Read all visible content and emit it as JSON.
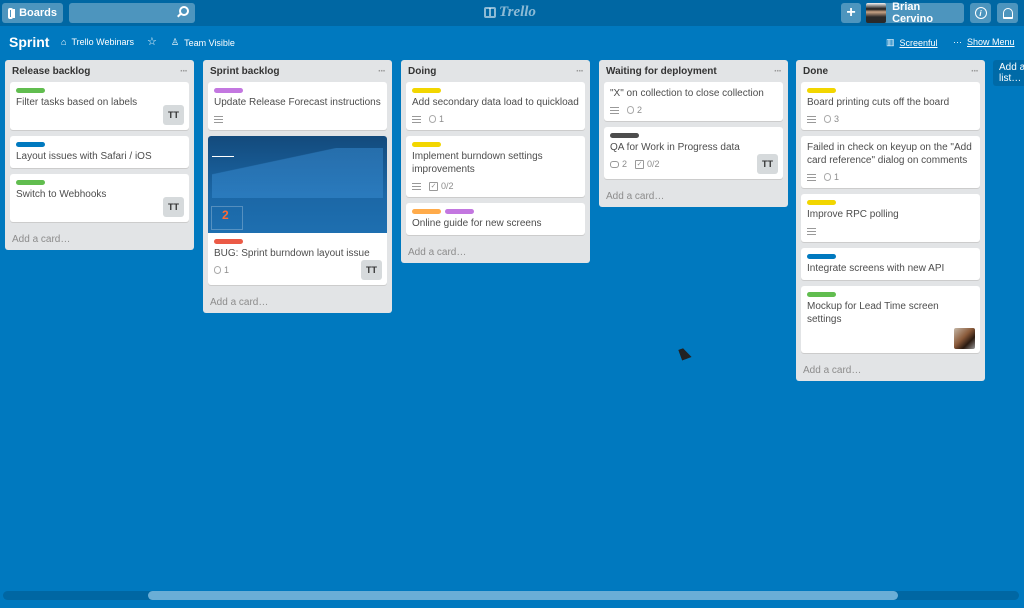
{
  "header": {
    "boards_label": "Boards",
    "search_placeholder": "",
    "logo_text": "Trello",
    "user_name": "Brian Cervino"
  },
  "board": {
    "title": "Sprint",
    "team": "Trello Webinars",
    "visibility": "Team Visible",
    "powerup": "Screenful",
    "menu": "Show Menu",
    "menu_dots": "···"
  },
  "colors": {
    "green": "#61bd4f",
    "blue": "#0079bf",
    "purple": "#c377e0",
    "red": "#eb5a46",
    "yellow": "#f2d600",
    "orange": "#ffab4a",
    "black": "#4d4d4d"
  },
  "add_card_label": "Add a card…",
  "add_list_label": "Add a list…",
  "lists": [
    {
      "title": "Release backlog",
      "cards": [
        {
          "labels": [
            "#61bd4f"
          ],
          "title": "Filter tasks based on labels",
          "member": "TT"
        },
        {
          "labels": [
            "#0079bf"
          ],
          "title": "Layout issues with Safari / iOS"
        },
        {
          "labels": [
            "#61bd4f"
          ],
          "title": "Switch to Webhooks",
          "member": "TT"
        }
      ]
    },
    {
      "title": "Sprint backlog",
      "cards": [
        {
          "labels": [
            "#c377e0"
          ],
          "title": "Update Release Forecast instructions",
          "description": true
        },
        {
          "cover": true,
          "cover_number": "2",
          "labels": [
            "#eb5a46"
          ],
          "title": "BUG: Sprint burndown layout issue",
          "attachments": "1",
          "member": "TT"
        }
      ]
    },
    {
      "title": "Doing",
      "cards": [
        {
          "labels": [
            "#f2d600"
          ],
          "title": "Add secondary data load to quickload",
          "description": true,
          "attachments": "1"
        },
        {
          "labels": [
            "#f2d600"
          ],
          "title": "Implement burndown settings improvements",
          "description": true,
          "checklist": "0/2"
        },
        {
          "labels": [
            "#ffab4a",
            "#c377e0"
          ],
          "title": "Online guide for new screens"
        }
      ]
    },
    {
      "title": "Waiting for deployment",
      "cards": [
        {
          "labels": [],
          "title": "\"X\" on collection to close collection",
          "description": true,
          "attachments": "2"
        },
        {
          "labels": [
            "#4d4d4d"
          ],
          "title": "QA for Work in Progress data",
          "comments": "2",
          "checklist": "0/2",
          "member": "TT"
        }
      ]
    },
    {
      "title": "Done",
      "cards": [
        {
          "labels": [
            "#f2d600"
          ],
          "title": "Board printing cuts off the board",
          "description": true,
          "attachments": "3"
        },
        {
          "labels": [],
          "title": "Failed in check on keyup on the \"Add card reference\" dialog on comments",
          "description": true,
          "attachments": "1"
        },
        {
          "labels": [
            "#f2d600"
          ],
          "title": "Improve RPC polling",
          "description": true
        },
        {
          "labels": [
            "#0079bf"
          ],
          "title": "Integrate screens with new API"
        },
        {
          "labels": [
            "#61bd4f"
          ],
          "title": "Mockup for Lead Time screen settings",
          "member_photo": true
        }
      ]
    }
  ]
}
